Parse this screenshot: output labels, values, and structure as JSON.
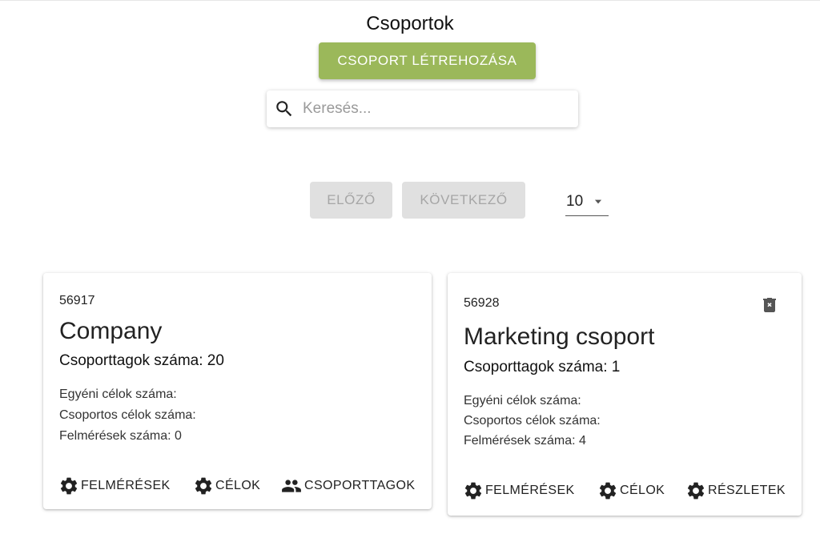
{
  "page": {
    "title": "Csoportok",
    "create_button": "CSOPORT LÉTREHOZÁSA",
    "search": {
      "placeholder": "Keresés...",
      "value": ""
    }
  },
  "pagination": {
    "prev_label": "ELŐZŐ",
    "next_label": "KÖVETKEZŐ",
    "page_size": "10"
  },
  "colors": {
    "accent": "#9bb85a",
    "disabled_bg": "#e0e0e0",
    "disabled_text": "#a6a6a6"
  },
  "cards": [
    {
      "id": "56917",
      "name": "Company",
      "members": "Csoporttagok száma: 20",
      "stats": [
        "Egyéni célok száma:",
        "Csoportos célok száma:",
        "Felmérések száma: 0"
      ],
      "actions": [
        {
          "label": "FELMÉRÉSEK",
          "icon": "gear-icon"
        },
        {
          "label": "CÉLOK",
          "icon": "gear-icon"
        },
        {
          "label": "CSOPORTTAGOK",
          "icon": "people-icon"
        }
      ]
    },
    {
      "id": "56928",
      "name": "Marketing csoport",
      "members": "Csoporttagok száma: 1",
      "stats": [
        "Egyéni célok száma:",
        "Csoportos célok száma:",
        "Felmérések száma: 4"
      ],
      "actions": [
        {
          "label": "FELMÉRÉSEK",
          "icon": "gear-icon"
        },
        {
          "label": "CÉLOK",
          "icon": "gear-icon"
        },
        {
          "label": "RÉSZLETEK",
          "icon": "gear-icon"
        }
      ],
      "delete_icon": "delete-icon"
    }
  ]
}
